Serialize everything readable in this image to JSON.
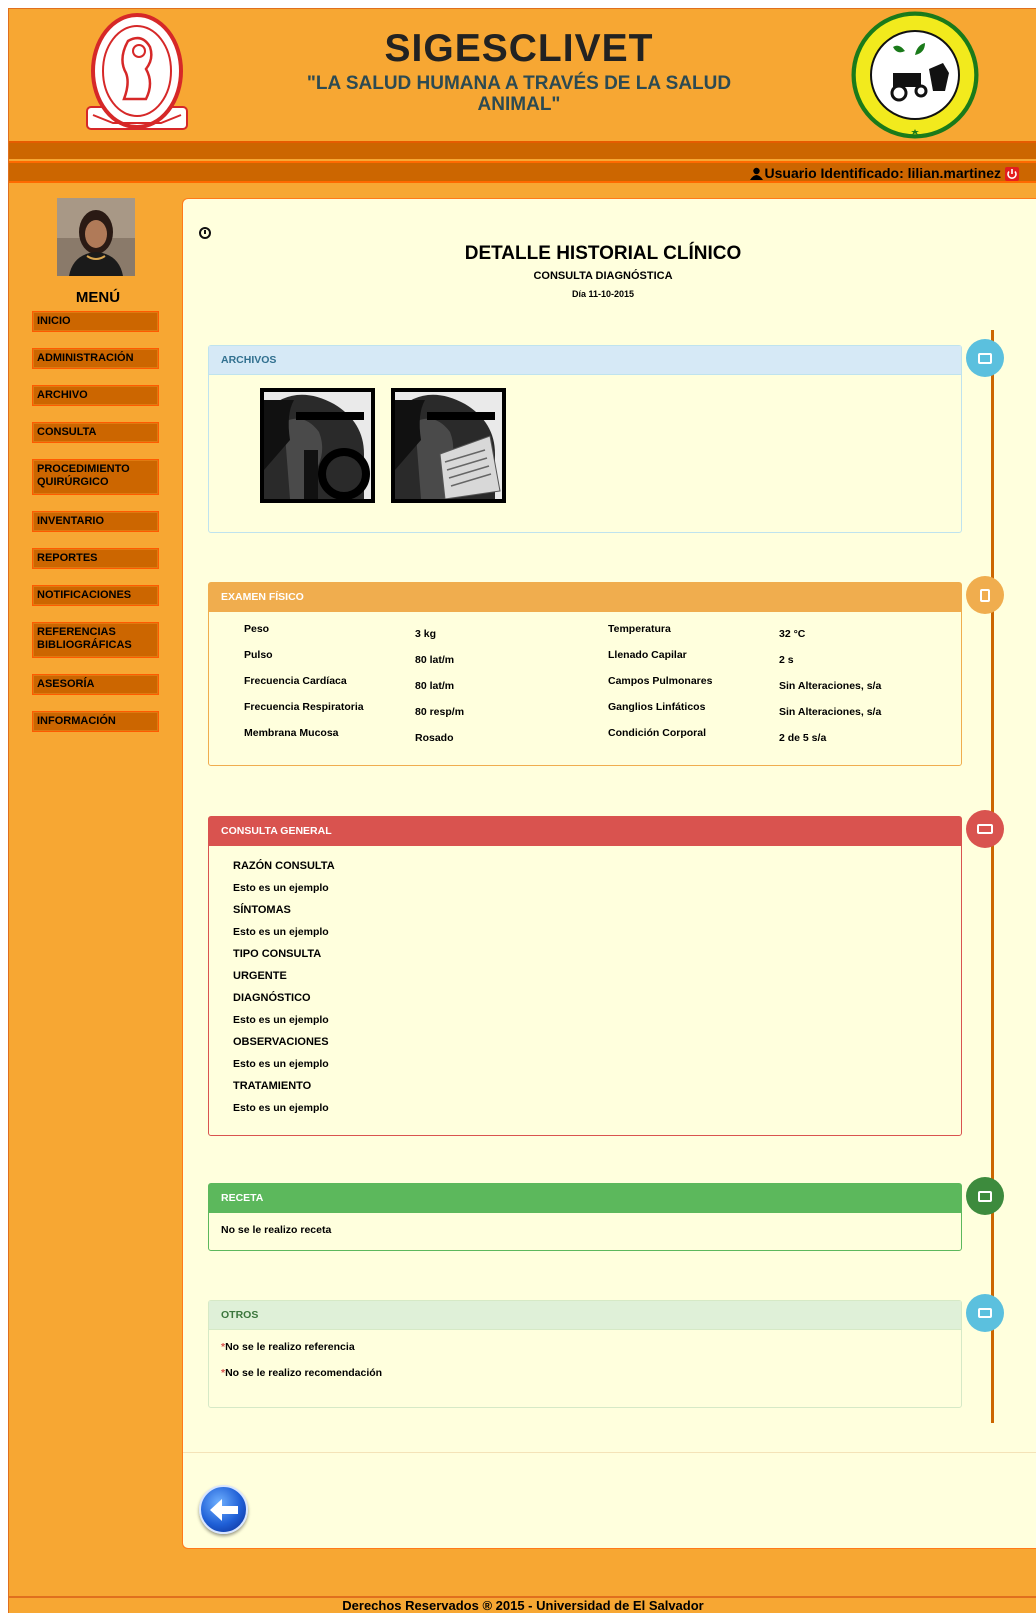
{
  "header": {
    "title": "SIGESCLIVET",
    "motto": "\"LA SALUD HUMANA A TRAVÉS DE LA SALUD ANIMAL\"",
    "user_label": "Usuario Identificado: lilian.martinez"
  },
  "sidebar": {
    "menu_title": "MENÚ",
    "items": [
      {
        "label": "INICIO"
      },
      {
        "label": "ADMINISTRACIÓN"
      },
      {
        "label": "ARCHIVO"
      },
      {
        "label": "CONSULTA"
      },
      {
        "label": "PROCEDIMIENTO QUIRÚRGICO"
      },
      {
        "label": "INVENTARIO"
      },
      {
        "label": "REPORTES"
      },
      {
        "label": "NOTIFICACIONES"
      },
      {
        "label": "REFERENCIAS BIBLIOGRÁFICAS"
      },
      {
        "label": "ASESORÍA"
      },
      {
        "label": "INFORMACIÓN"
      }
    ]
  },
  "page": {
    "title": "DETALLE HISTORIAL CLÍNICO",
    "subtitle": "CONSULTA DIAGNÓSTICA",
    "date": "Día 11-10-2015"
  },
  "archivos": {
    "heading": "ARCHIVOS",
    "icon": "picture-icon"
  },
  "examen": {
    "heading": "EXAMEN FÍSICO",
    "icon": "clipboard-icon",
    "rows": [
      {
        "l1": "Peso",
        "v1": "3  kg",
        "l2": "Temperatura",
        "v2": "32  °C"
      },
      {
        "l1": "Pulso",
        "v1": "80  lat/m",
        "l2": "Llenado Capilar",
        "v2": "2  s"
      },
      {
        "l1": "Frecuencia Cardíaca",
        "v1": "80  lat/m",
        "l2": "Campos Pulmonares",
        "v2": "Sin Alteraciones,  s/a"
      },
      {
        "l1": "Frecuencia Respiratoria",
        "v1": "80  resp/m",
        "l2": "Ganglios Linfáticos",
        "v2": "Sin Alteraciones,  s/a"
      },
      {
        "l1": "Membrana Mucosa",
        "v1": "Rosado",
        "l2": "Condición Corporal",
        "v2": "2 de 5  s/a"
      }
    ]
  },
  "consulta": {
    "heading": "CONSULTA GENERAL",
    "icon": "ambulance-icon",
    "razon_label": "RAZÓN CONSULTA",
    "razon_value": "Esto es un ejemplo",
    "sintomas_label": "SÍNTOMAS",
    "sintomas_value": "Esto es un ejemplo",
    "tipo_label": "TIPO CONSULTA",
    "tipo_value": "URGENTE",
    "diagnostico_label": "DIAGNÓSTICO",
    "diagnostico_value": "Esto es un ejemplo",
    "observaciones_label": "OBSERVACIONES",
    "observaciones_value": "Esto es un ejemplo",
    "tratamiento_label": "TRATAMIENTO",
    "tratamiento_value": "Esto es un ejemplo"
  },
  "receta": {
    "heading": "RECETA",
    "icon": "medkit-icon",
    "text": "No se le realizo receta"
  },
  "otros": {
    "heading": "OTROS",
    "icon": "folder-icon",
    "line1": "No se le realizo referencia",
    "line2": "No se le realizo recomendación"
  },
  "footer": {
    "text": "Derechos Reservados ® 2015 - Universidad de El Salvador"
  },
  "colors": {
    "page_bg": "#f7a733",
    "menu_item_bg": "#cc6600",
    "content_bg": "#ffffdd",
    "timeline": "#cc6600",
    "info": "#5bc0de",
    "warning": "#f0ad4e",
    "danger": "#d9534f",
    "success": "#5cb85c"
  }
}
